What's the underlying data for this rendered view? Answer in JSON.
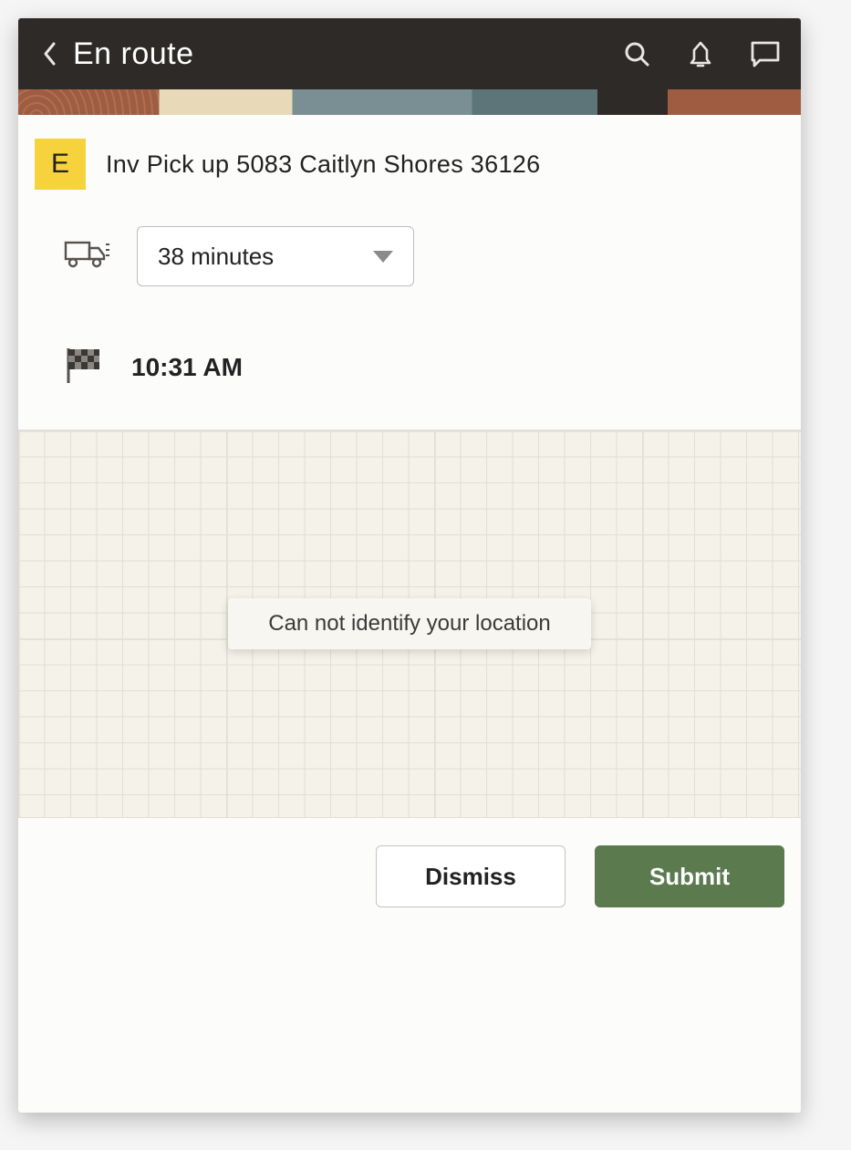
{
  "header": {
    "title": "En route"
  },
  "activity": {
    "badge_letter": "E",
    "title": "Inv Pick up 5083 Caitlyn Shores 36126"
  },
  "duration": {
    "selected": "38 minutes"
  },
  "arrival": {
    "time": "10:31 AM"
  },
  "map": {
    "toast": "Can not identify your location"
  },
  "buttons": {
    "dismiss": "Dismiss",
    "submit": "Submit"
  }
}
